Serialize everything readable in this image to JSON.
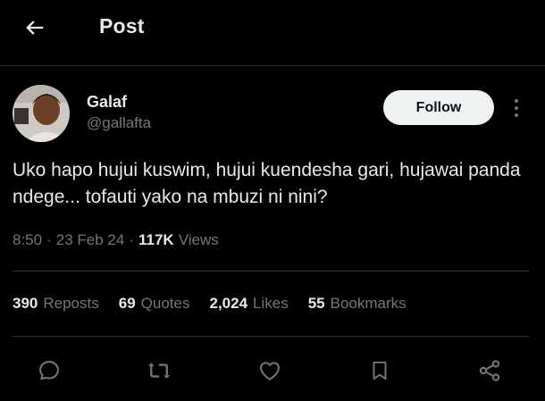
{
  "header": {
    "title": "Post",
    "back_icon": "arrow-left-icon"
  },
  "tweet": {
    "author": {
      "display_name": "Galaf",
      "handle": "@gallafta"
    },
    "follow_label": "Follow",
    "text": "Uko hapo hujui kuswim, hujui kuendesha gari, hujawai panda ndege... tofauti yako na mbuzi ni nini?",
    "time": "8:50",
    "date": "23 Feb 24",
    "views_count": "117K",
    "views_label": "Views"
  },
  "stats": [
    {
      "count": "390",
      "label": "Reposts"
    },
    {
      "count": "69",
      "label": "Quotes"
    },
    {
      "count": "2,024",
      "label": "Likes"
    },
    {
      "count": "55",
      "label": "Bookmarks"
    }
  ],
  "actions": [
    "reply-icon",
    "repost-icon",
    "like-icon",
    "bookmark-icon",
    "share-icon"
  ],
  "colors": {
    "background": "#000000",
    "text": "#e7e9ea",
    "muted": "#71767b",
    "divider": "#2f3336",
    "follow_bg": "#eff3f4"
  }
}
